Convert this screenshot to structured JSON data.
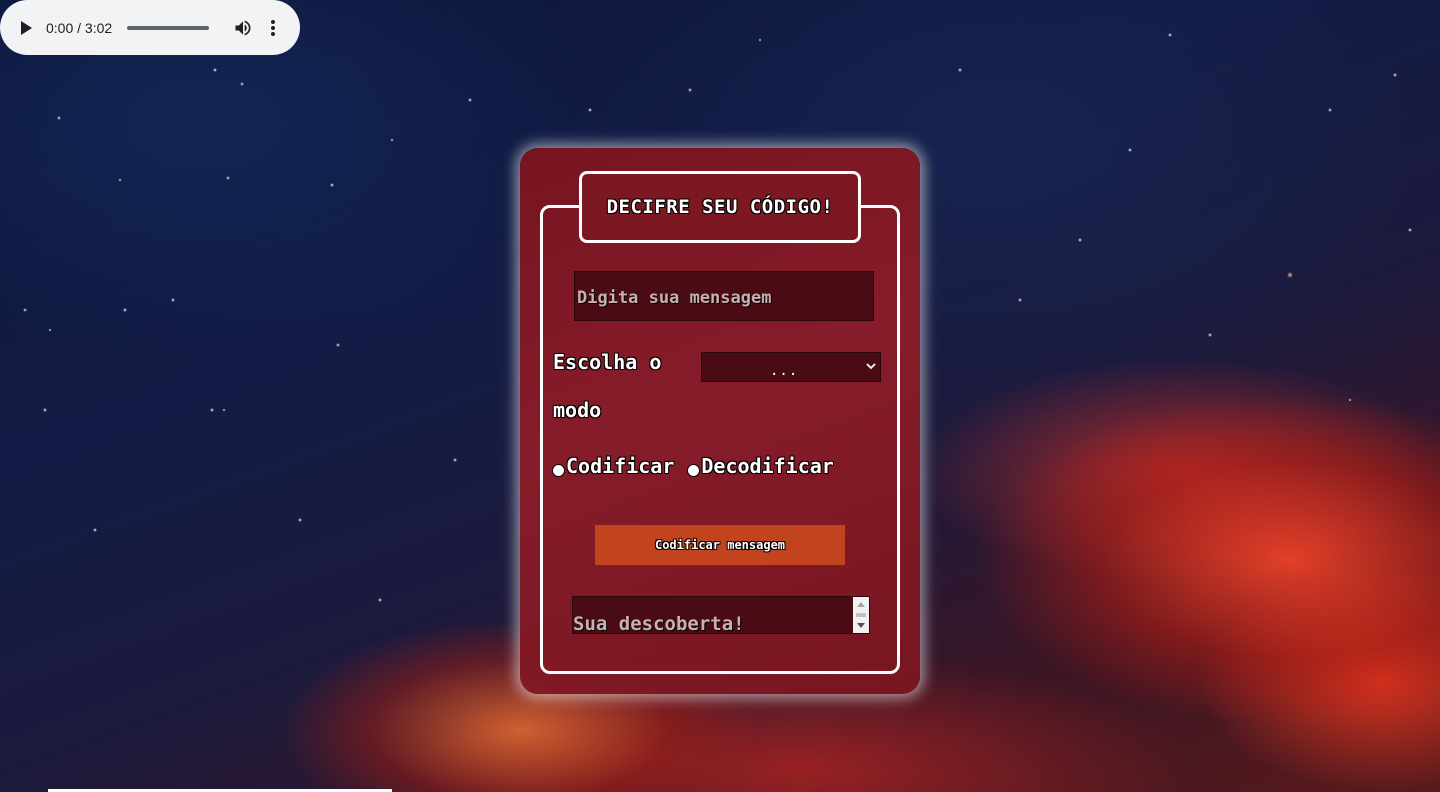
{
  "audio_player": {
    "time": "0:00 / 3:02",
    "progress": 0
  },
  "card": {
    "title": "DECIFRE SEU CÓDIGO!",
    "message_input": {
      "placeholder": "Digita sua mensagem"
    },
    "mode_label": "Escolha o modo",
    "mode_select": {
      "value": "..."
    },
    "radios": [
      {
        "label": "Codificar"
      },
      {
        "label": "Decodificar"
      }
    ],
    "submit_button": "Codificar mensagem",
    "result_area": {
      "placeholder": "Sua descoberta!"
    }
  },
  "icons": {
    "play": "play-icon",
    "volume": "volume-icon",
    "more": "more-vert-icon",
    "dropdown": "chevron-down-icon"
  },
  "colors": {
    "card_bg": "#7c1822",
    "button_bg": "#c2441e",
    "input_bg": "#4a0c14",
    "player_bg": "#f1f3f4"
  }
}
